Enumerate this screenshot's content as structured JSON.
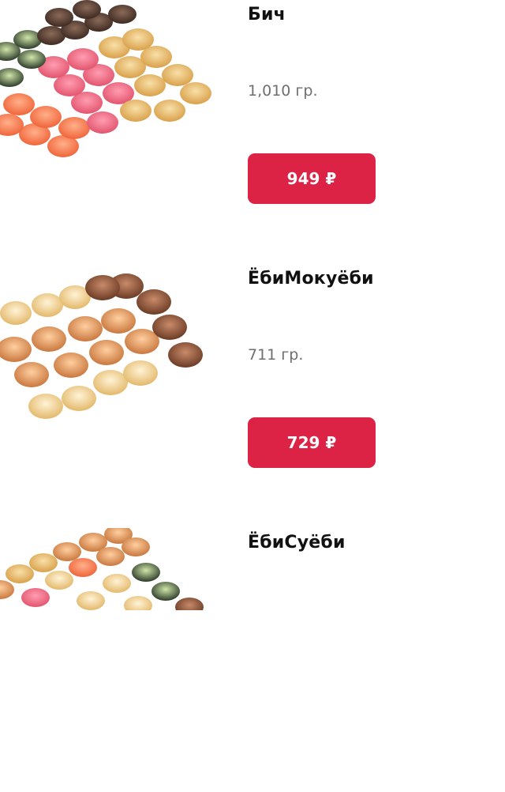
{
  "products": [
    {
      "name": "Бич",
      "weight": "1,010 гр.",
      "price": "949 ₽"
    },
    {
      "name": "ЁбиМокуёби",
      "weight": "711 гр.",
      "price": "729 ₽"
    },
    {
      "name": "ЁбиСуёби"
    }
  ],
  "colors": {
    "price_button": "#dc2245",
    "title": "#111111",
    "weight": "#6f6f6f"
  }
}
